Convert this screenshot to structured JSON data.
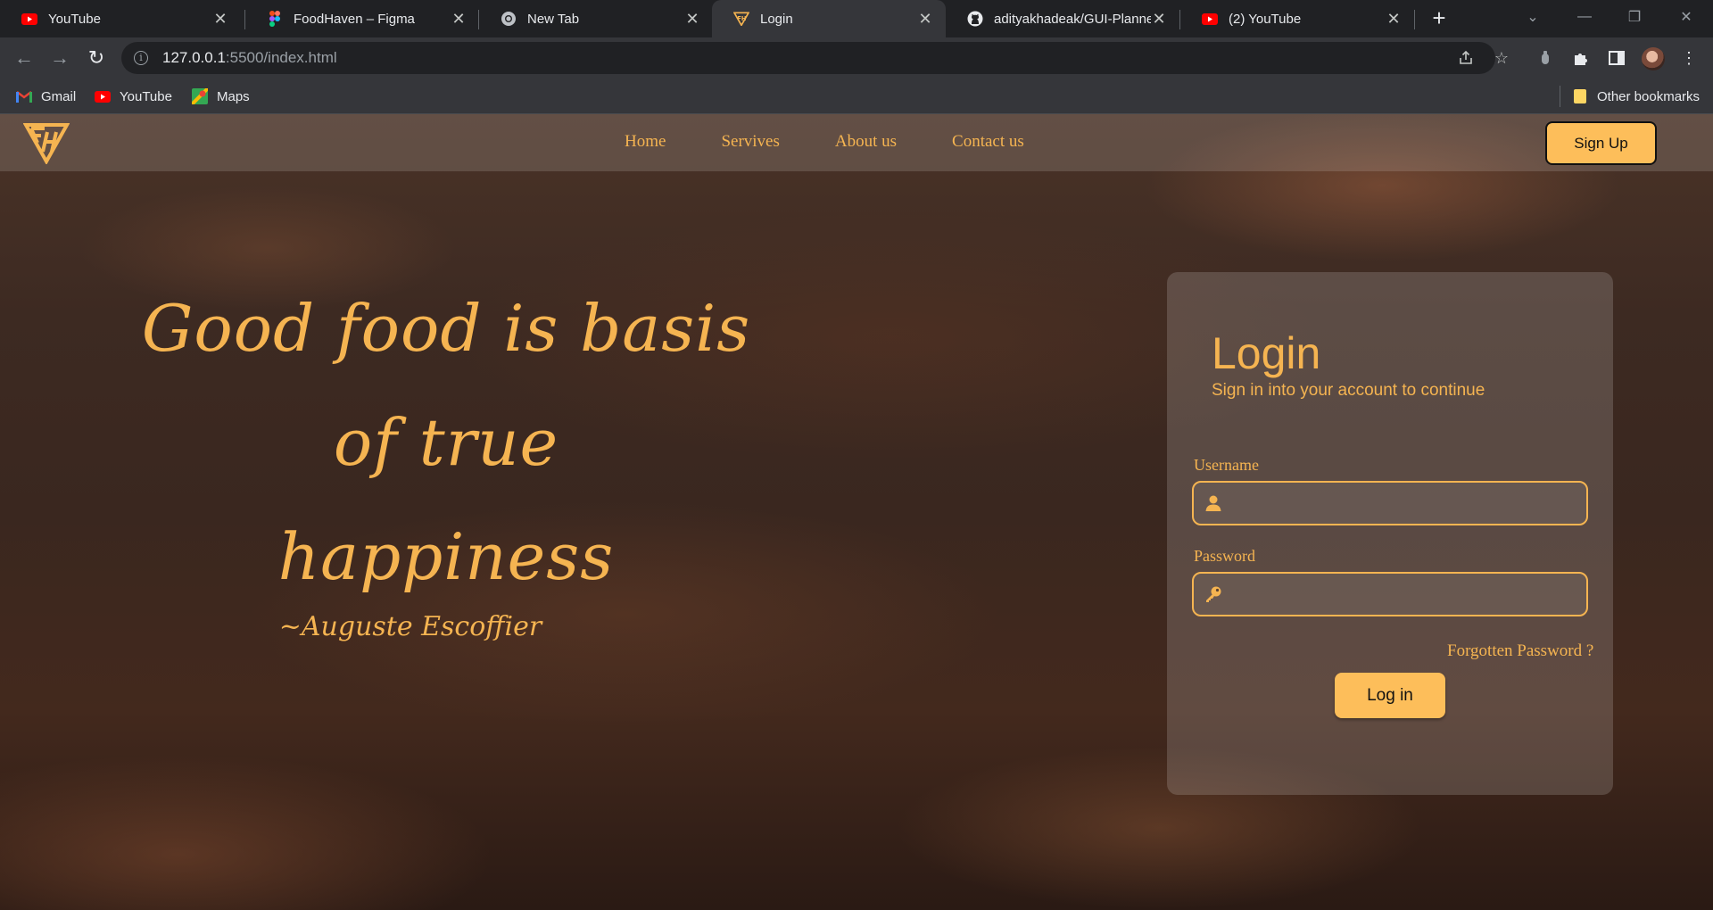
{
  "browser": {
    "tabs": [
      {
        "title": "YouTube",
        "icon": "youtube-icon"
      },
      {
        "title": "FoodHaven – Figma",
        "icon": "figma-icon"
      },
      {
        "title": "New Tab",
        "icon": "chrome-icon"
      },
      {
        "title": "Login",
        "icon": "foodhaven-logo-icon"
      },
      {
        "title": "adityakhadeak/GUI-Planner",
        "icon": "github-icon"
      },
      {
        "title": "(2) YouTube",
        "icon": "youtube-icon"
      }
    ],
    "active_tab": 3,
    "url_host": "127.0.0.1",
    "url_path": ":5500/index.html",
    "bookmarks": [
      {
        "label": "Gmail",
        "icon": "gmail-icon"
      },
      {
        "label": "YouTube",
        "icon": "youtube-icon"
      },
      {
        "label": "Maps",
        "icon": "maps-icon"
      }
    ],
    "other_bookmarks": "Other bookmarks"
  },
  "site": {
    "nav": [
      "Home",
      "Servives",
      "About us",
      "Contact us"
    ],
    "signup_label": "Sign Up",
    "quote_line1": "Good food is basis of true",
    "quote_line2": "happiness",
    "quote_author": "~Auguste Escoffier"
  },
  "login": {
    "title": "Login",
    "subtitle": "Sign in into your account to continue",
    "username_label": "Username",
    "username_value": "",
    "password_label": "Password",
    "password_value": "",
    "forgot_label": "Forgotten Password ?",
    "submit_label": "Log in"
  },
  "colors": {
    "accent": "#f5b451",
    "button": "#fdbe5a",
    "chrome_dark": "#202124",
    "chrome_toolbar": "#35363a"
  }
}
